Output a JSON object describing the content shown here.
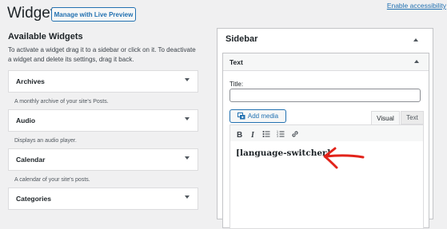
{
  "header": {
    "title": "Widgets",
    "manage_button": "Manage with Live Preview",
    "accessibility_link": "Enable accessibility"
  },
  "available": {
    "heading": "Available Widgets",
    "description": "To activate a widget drag it to a sidebar or click on it. To deactivate a widget and delete its settings, drag it back.",
    "widgets": [
      {
        "title": "Archives",
        "description": "A monthly archive of your site's Posts."
      },
      {
        "title": "Audio",
        "description": "Displays an audio player."
      },
      {
        "title": "Calendar",
        "description": "A calendar of your site's posts."
      },
      {
        "title": "Categories",
        "description": ""
      }
    ]
  },
  "sidebar": {
    "title": "Sidebar",
    "text_widget": {
      "title": "Text",
      "title_label": "Title:",
      "title_value": "",
      "add_media": "Add media",
      "tabs": {
        "visual": "Visual",
        "text": "Text"
      },
      "toolbar": [
        "bold-icon",
        "italic-icon",
        "bulleted-list-icon",
        "numbered-list-icon",
        "link-icon"
      ],
      "content": "[language-switcher]"
    }
  },
  "colors": {
    "accent": "#2271b1",
    "annotation_arrow": "#e2231a",
    "background": "#f0f0f1"
  }
}
